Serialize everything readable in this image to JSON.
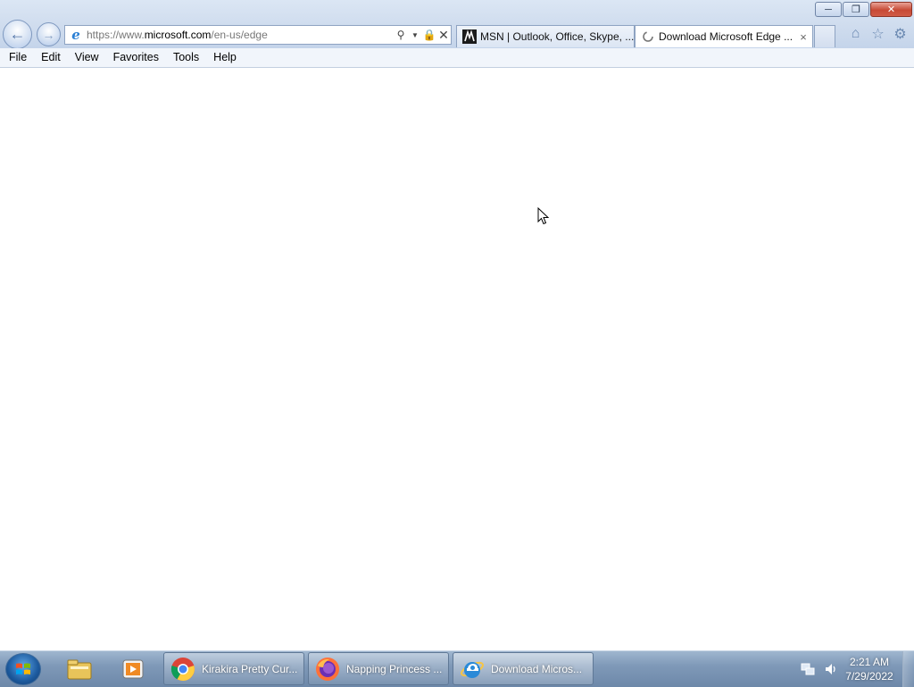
{
  "window": {
    "controls": {
      "minimize_icon": "minimize-icon",
      "restore_icon": "restore-icon",
      "close_icon": "close-icon"
    }
  },
  "navigation": {
    "back_icon": "back-arrow-icon",
    "forward_icon": "forward-arrow-icon"
  },
  "address_bar": {
    "url_prefix": "https://www.",
    "url_domain": "microsoft.com",
    "url_path": "/en-us/edge",
    "icons": [
      "search-icon",
      "dropdown-icon",
      "lock-icon",
      "stop-icon"
    ]
  },
  "tabs": [
    {
      "label": "MSN | Outlook, Office, Skype, ...",
      "icon": "msn-icon",
      "active": false
    },
    {
      "label": "Download Microsoft Edge ...",
      "icon": "loading-icon",
      "active": true,
      "close": "×"
    }
  ],
  "command_icons": [
    "home-icon",
    "favorites-star-icon",
    "settings-gear-icon"
  ],
  "menu": {
    "items": [
      "File",
      "Edit",
      "View",
      "Favorites",
      "Tools",
      "Help"
    ]
  },
  "taskbar": {
    "pinned": [
      "windows-explorer-icon",
      "media-player-icon"
    ],
    "tasks": [
      {
        "label": "Kirakira Pretty Cur...",
        "icon": "chrome-icon",
        "active": false
      },
      {
        "label": "Napping Princess ...",
        "icon": "firefox-icon",
        "active": false
      },
      {
        "label": "Download Micros...",
        "icon": "internet-explorer-icon",
        "active": true
      }
    ],
    "tray": {
      "icons": [
        "network-icon",
        "volume-icon"
      ],
      "time": "2:21 AM",
      "date": "7/29/2022"
    }
  },
  "colors": {
    "chrome_bg": "#cfdcee",
    "taskbar_bg": "#7f99b8",
    "close_red": "#c74a36"
  }
}
